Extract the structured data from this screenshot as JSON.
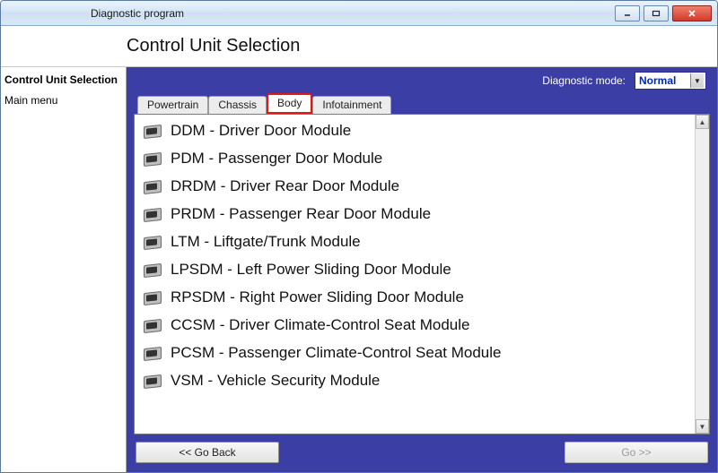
{
  "window": {
    "title": "Diagnostic program"
  },
  "header": {
    "title": "Control Unit Selection"
  },
  "sidebar": {
    "items": [
      {
        "label": "Control Unit Selection",
        "bold": true
      },
      {
        "label": "Main menu",
        "bold": false
      }
    ]
  },
  "diagnostic_mode": {
    "label": "Diagnostic mode:",
    "value": "Normal"
  },
  "tabs": [
    {
      "label": "Powertrain",
      "active": false
    },
    {
      "label": "Chassis",
      "active": false
    },
    {
      "label": "Body",
      "active": true
    },
    {
      "label": "Infotainment",
      "active": false
    }
  ],
  "modules": [
    "DDM - Driver Door Module",
    "PDM - Passenger Door Module",
    "DRDM - Driver Rear Door Module",
    "PRDM - Passenger Rear Door Module",
    "LTM - Liftgate/Trunk Module",
    "LPSDM - Left Power Sliding Door Module",
    "RPSDM - Right Power Sliding Door Module",
    "CCSM - Driver Climate-Control Seat Module",
    "PCSM - Passenger Climate-Control Seat Module",
    "VSM - Vehicle Security Module"
  ],
  "buttons": {
    "back": "<< Go Back",
    "go": "Go >>"
  }
}
